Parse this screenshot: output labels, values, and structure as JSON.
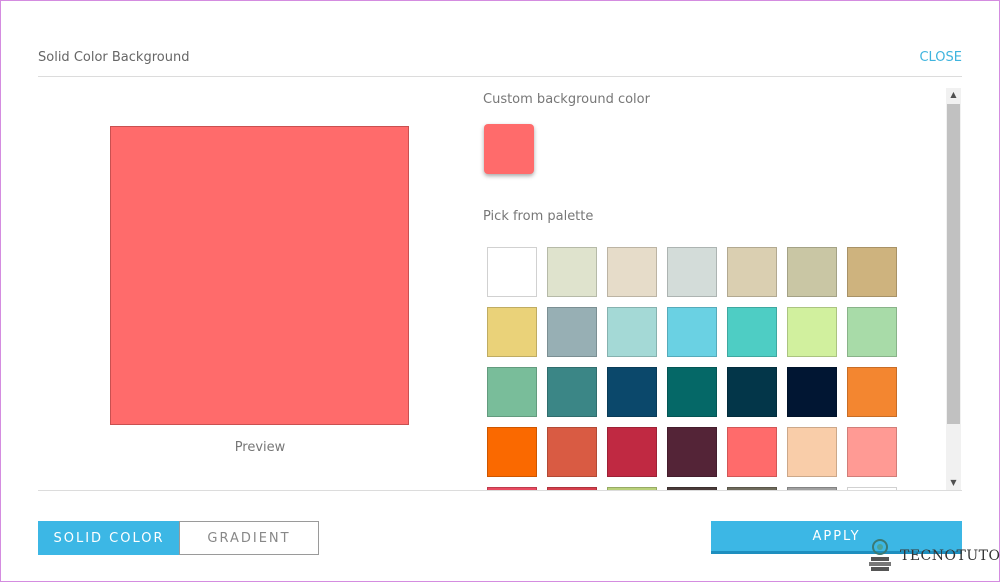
{
  "header": {
    "title": "Solid Color Background",
    "close_label": "CLOSE"
  },
  "preview": {
    "color": "#ff6b6b",
    "label": "Preview"
  },
  "custom": {
    "label": "Custom background color",
    "color": "#ff6b6b"
  },
  "palette": {
    "label": "Pick from palette",
    "colors": [
      "#ffffff",
      "#dfe3cd",
      "#e6dcc9",
      "#d3dcd9",
      "#dacfb1",
      "#c9c6a4",
      "#ceb37e",
      "#ead279",
      "#97afb4",
      "#a4d9d6",
      "#6ad1e3",
      "#4ecdc4",
      "#d1f09e",
      "#a8dba8",
      "#79bd9a",
      "#3b8686",
      "#0b486b",
      "#056867",
      "#033649",
      "#011633",
      "#f38630",
      "#fa6900",
      "#d95b43",
      "#c02942",
      "#542437",
      "#ff6b6b",
      "#f9cda9",
      "#ff9a94",
      "#e84a5f",
      "#d53f4b",
      "#b9d07a",
      "#4a3b3a",
      "#6e6a5b",
      "#a0a0a0",
      "#ffffff"
    ]
  },
  "scrollbar": {
    "up_icon": "▲",
    "down_icon": "▼"
  },
  "footer": {
    "solid_label": "SOLID COLOR",
    "gradient_label": "GRADIENT",
    "apply_label": "APPLY"
  },
  "watermark": {
    "text": "TECNOTUTO"
  }
}
